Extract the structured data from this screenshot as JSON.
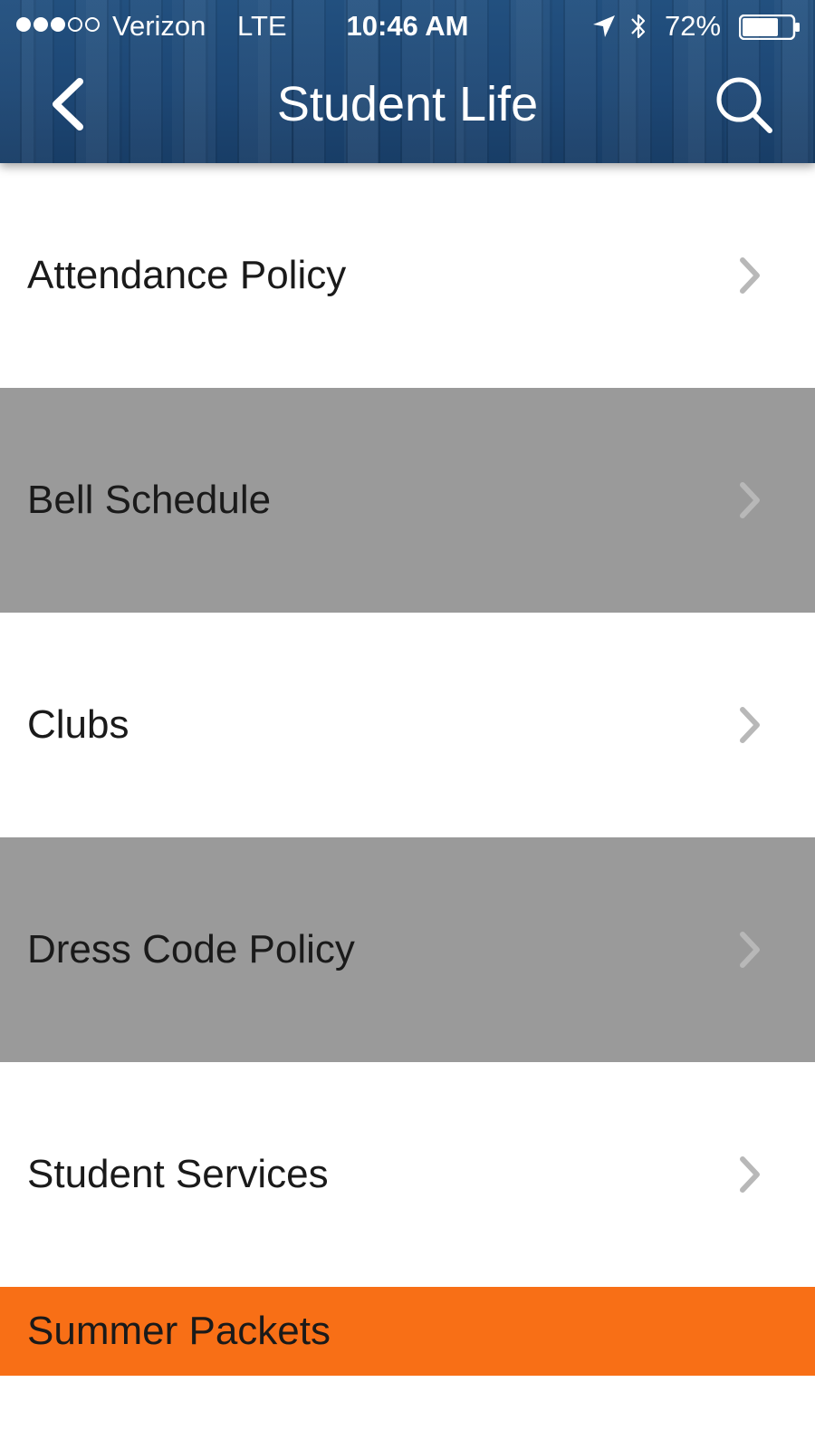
{
  "status_bar": {
    "carrier": "Verizon",
    "network": "LTE",
    "time": "10:46 AM",
    "battery": "72%",
    "signal_bars_filled": 3,
    "signal_bars_total": 5,
    "battery_level": 0.72
  },
  "header": {
    "title": "Student Life",
    "back_icon": "chevron-left-icon",
    "search_icon": "search-icon"
  },
  "menu": {
    "items": [
      {
        "label": "Attendance Policy"
      },
      {
        "label": "Bell Schedule"
      },
      {
        "label": "Clubs"
      },
      {
        "label": "Dress Code Policy"
      },
      {
        "label": "Student Services"
      }
    ],
    "highlight_item": {
      "label": "Summer Packets"
    }
  },
  "colors": {
    "header_blue": "#1d4775",
    "row_gray": "#9a9a9a",
    "accent_orange": "#f86f16",
    "chevron_gray": "#b8b8b8"
  }
}
